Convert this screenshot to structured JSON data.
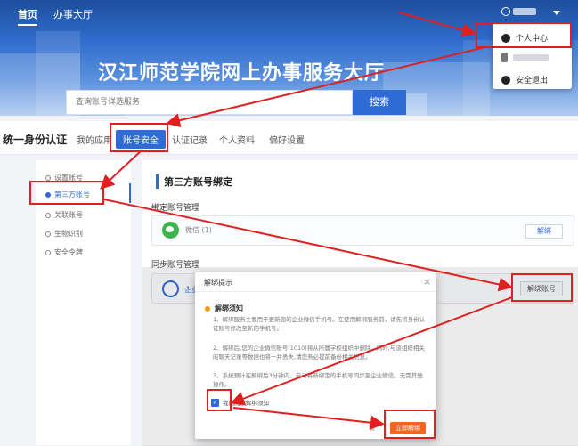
{
  "nav": {
    "home": "首页",
    "hall": "办事大厅"
  },
  "hero": {
    "title": "汉江师范学院网上办事服务大厅",
    "search_placeholder": "查询账号详选服务",
    "search_button": "搜索"
  },
  "dropdown": {
    "item1": "个人中心",
    "item3": "安全退出"
  },
  "tabbar": {
    "title": "统一身份认证",
    "tabs": [
      "我的应用",
      "账号安全",
      "认证记录",
      "个人资料",
      "偏好设置"
    ]
  },
  "sidebar": {
    "items": [
      "设置账号",
      "第三方账号",
      "关联账号",
      "生物识别",
      "安全令牌"
    ]
  },
  "content": {
    "section_title": "第三方账号绑定",
    "bound_title": "绑定账号管理",
    "wechat_label": "微信 (1)",
    "unbind1": "解绑",
    "sync_title": "同步账号管理",
    "wecom_label": "企业",
    "unbind2": "解绑账号"
  },
  "modal": {
    "title": "解绑提示",
    "close": "×",
    "notice_head": "解绑须知",
    "p1": "1、解绑服务主要用于更新您的企业微信手机号。在使用解绑服务前，请先将身份认证账号修改至新的手机号。",
    "p2": "2、解绑后,您的企业微信账号(1010)将从所属学校组织中删除。同时,与该组织相关的聊天记录等数据也将一并丢失,请您务必提前备份相关信息。",
    "p3": "3、系统预计在解绑后3分钟内，自动将新绑定的手机号同步至企业微信。无需其他操作。",
    "agree": "我已阅读解绑须知",
    "cancel": "取",
    "confirm": "立即解绑"
  },
  "colors": {
    "primary": "#2e6bd6",
    "highlight": "#e02020",
    "confirm": "#f26522"
  }
}
